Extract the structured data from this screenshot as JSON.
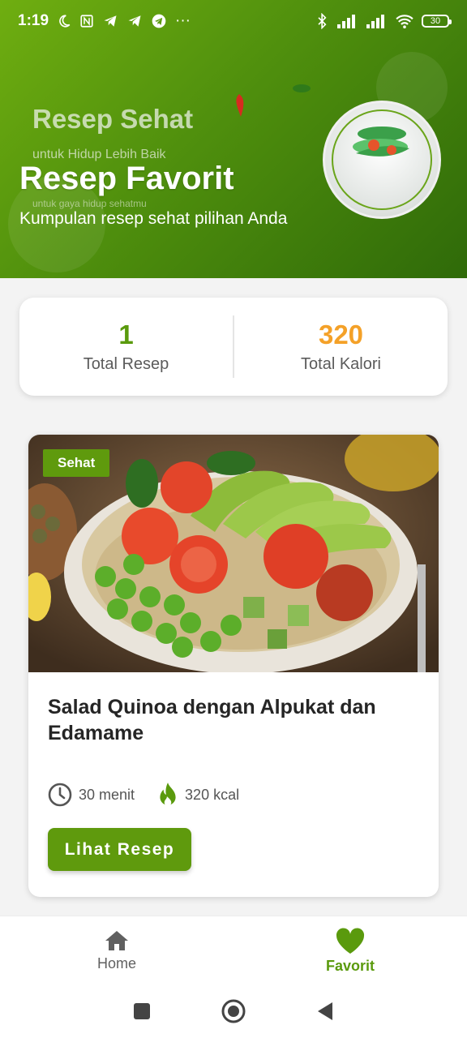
{
  "status_bar": {
    "time": "1:19",
    "more": "···",
    "battery": "30"
  },
  "header": {
    "bg_title": "Resep Sehat",
    "bg_subtitle": "untuk Hidup Lebih Baik",
    "bg_small_text": "untuk gaya hidup sehatmu",
    "title": "Resep Favorit",
    "subtitle": "Kumpulan resep sehat pilihan Anda"
  },
  "stats": {
    "total_recipes_value": "1",
    "total_recipes_label": "Total Resep",
    "total_calories_value": "320",
    "total_calories_label": "Total Kalori"
  },
  "recipe": {
    "badge": "Sehat",
    "title": "Salad Quinoa dengan Alpukat dan Edamame",
    "time": "30 menit",
    "calories": "320 kcal",
    "button_label": "Lihat Resep"
  },
  "bottom_nav": {
    "items": [
      {
        "label": "Home",
        "icon": "home-icon",
        "active": false
      },
      {
        "label": "Favorit",
        "icon": "heart-icon",
        "active": true
      }
    ]
  },
  "colors": {
    "primary": "#5f9a0d",
    "accent_orange": "#f4a128"
  }
}
